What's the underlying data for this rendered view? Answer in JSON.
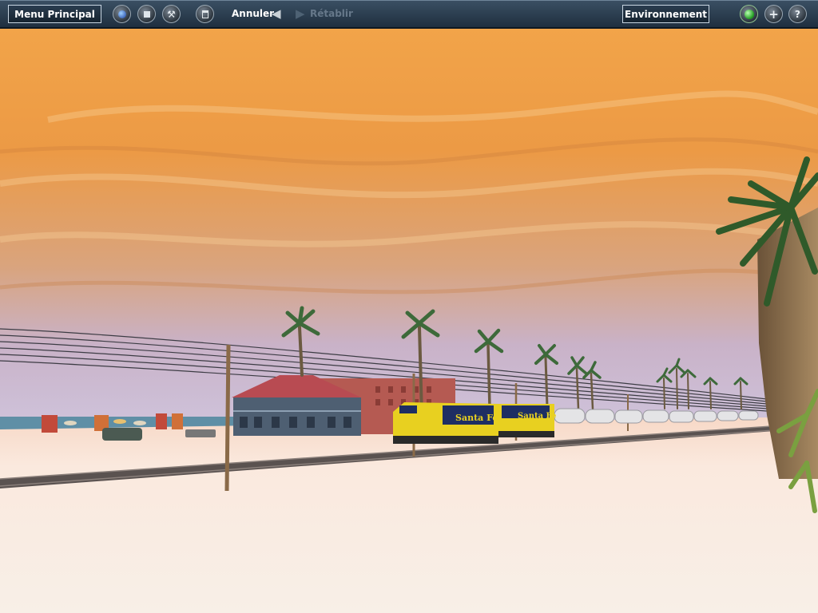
{
  "toolbar": {
    "main_menu": "Menu Principal",
    "undo": "Annuler",
    "redo": "Rétablir",
    "environment": "Environnement"
  },
  "scene": {
    "locomotive_lettering": "Santa Fe"
  },
  "colors": {
    "toolbar_bg": "#2a3d50",
    "sky_top": "#f0a040",
    "sky_bottom": "#d8c8e0",
    "sand": "#f7ece2",
    "locomotive_yellow": "#e8d020",
    "locomotive_blue": "#1e2e63",
    "status_green": "#22aa22"
  },
  "icons": [
    "camera-icon",
    "stop-icon",
    "tool-icon",
    "trash-icon",
    "undo-arrow-icon",
    "redo-arrow-icon",
    "green-light-icon",
    "plus-icon",
    "help-icon"
  ]
}
